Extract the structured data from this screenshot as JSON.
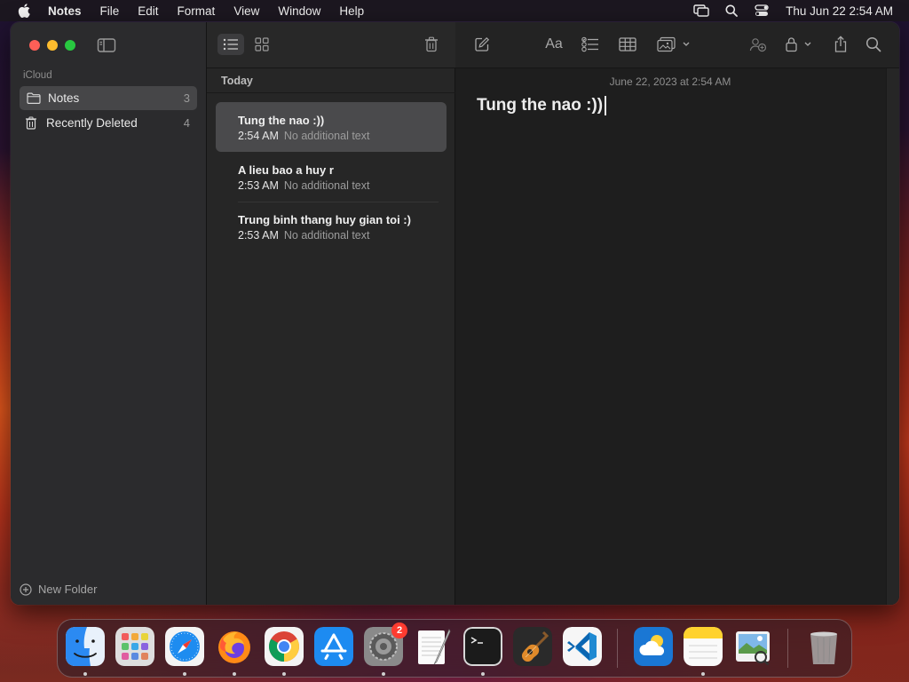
{
  "menubar": {
    "app_name": "Notes",
    "menus": [
      "File",
      "Edit",
      "Format",
      "View",
      "Window",
      "Help"
    ],
    "clock": "Thu Jun 22  2:54 AM"
  },
  "sidebar": {
    "section_label": "iCloud",
    "folders": [
      {
        "label": "Notes",
        "count": "3"
      },
      {
        "label": "Recently Deleted",
        "count": "4"
      }
    ],
    "new_folder_label": "New Folder"
  },
  "note_list": {
    "group_header": "Today",
    "notes": [
      {
        "title": "Tung the nao :))",
        "time": "2:54 AM",
        "preview": "No additional text"
      },
      {
        "title": "A lieu bao a huy r",
        "time": "2:53 AM",
        "preview": "No additional text"
      },
      {
        "title": "Trung binh thang huy gian toi :)",
        "time": "2:53 AM",
        "preview": "No additional text"
      }
    ]
  },
  "editor": {
    "date_line": "June 22, 2023 at 2:54 AM",
    "body_text": "Tung the nao :))",
    "format_button_label": "Aa"
  },
  "dock": {
    "apps": [
      "Finder",
      "Launchpad",
      "Safari",
      "Firefox",
      "Chrome",
      "App Store",
      "System Settings",
      "TextEdit",
      "Terminal",
      "GarageBand",
      "Visual Studio Code",
      "Weather",
      "Notes",
      "Preview",
      "Trash"
    ],
    "settings_badge": "2"
  }
}
